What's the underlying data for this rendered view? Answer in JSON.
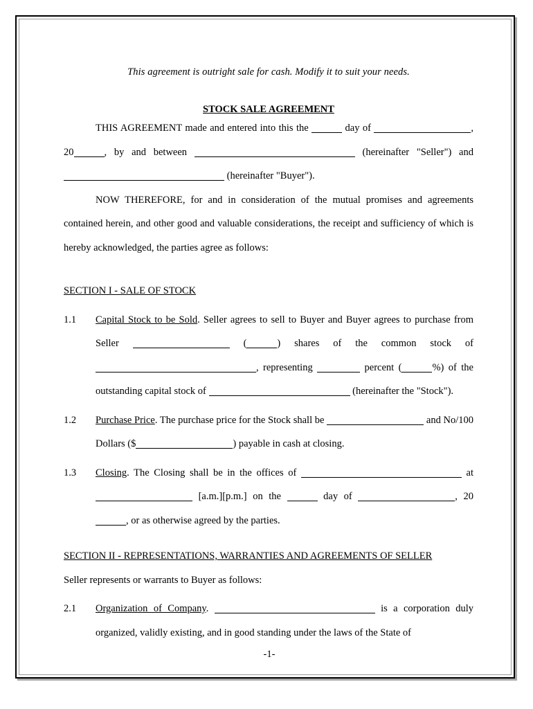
{
  "document": {
    "lede": "This agreement is outright sale for cash. Modify it to suit your needs.",
    "title": "STOCK SALE AGREEMENT",
    "page_number": "-1-"
  },
  "preamble": {
    "p1": {
      "t1": "THIS AGREEMENT made and entered into this the ",
      "t2": " day of ",
      "t3": ", 20",
      "t4": ", by and between ",
      "t5": " (hereinafter \"Seller\") and ",
      "t6": " (hereinafter \"Buyer\")."
    },
    "p2": "NOW THEREFORE, for and in consideration of the mutual promises and agreements contained herein, and other good and valuable considerations, the receipt and sufficiency of which is hereby acknowledged, the parties agree as follows:"
  },
  "section1": {
    "heading": "SECTION I - SALE OF STOCK ",
    "clauses": [
      {
        "number": "1.1",
        "title": "Capital Stock to be Sold",
        "t1": ".  Seller agrees to sell to Buyer and Buyer agrees to purchase from Seller ",
        "t2": " (",
        "t3": ") shares of the common stock of ",
        "t4": ", representing ",
        "t5": " percent (",
        "t6": "%) of the outstanding capital stock of ",
        "t7": " (hereinafter the \"Stock\")."
      },
      {
        "number": "1.2",
        "title": "Purchase Price",
        "t1": ".   The purchase price for the Stock shall be ",
        "t2": " and No/100 Dollars ($",
        "t3": ") payable in cash at closing."
      },
      {
        "number": "1.3",
        "title": "Closing",
        "t1": ".  The Closing shall be in the offices of ",
        "t2": " at ",
        "t3": " [a.m.][p.m.] on the ",
        "t4": " day of ",
        "t5": ", 20",
        "t6": ", or as otherwise agreed by the parties."
      }
    ]
  },
  "section2": {
    "heading": "SECTION II - REPRESENTATIONS, WARRANTIES AND AGREEMENTS OF SELLER",
    "intro": "Seller represents or warrants to Buyer as follows:",
    "clauses": [
      {
        "number": "2.1",
        "title": "Organization of Company",
        "t1": ".  ",
        "t2": " is a corporation duly organized, validly existing, and in good standing under the laws of the State of"
      }
    ]
  }
}
